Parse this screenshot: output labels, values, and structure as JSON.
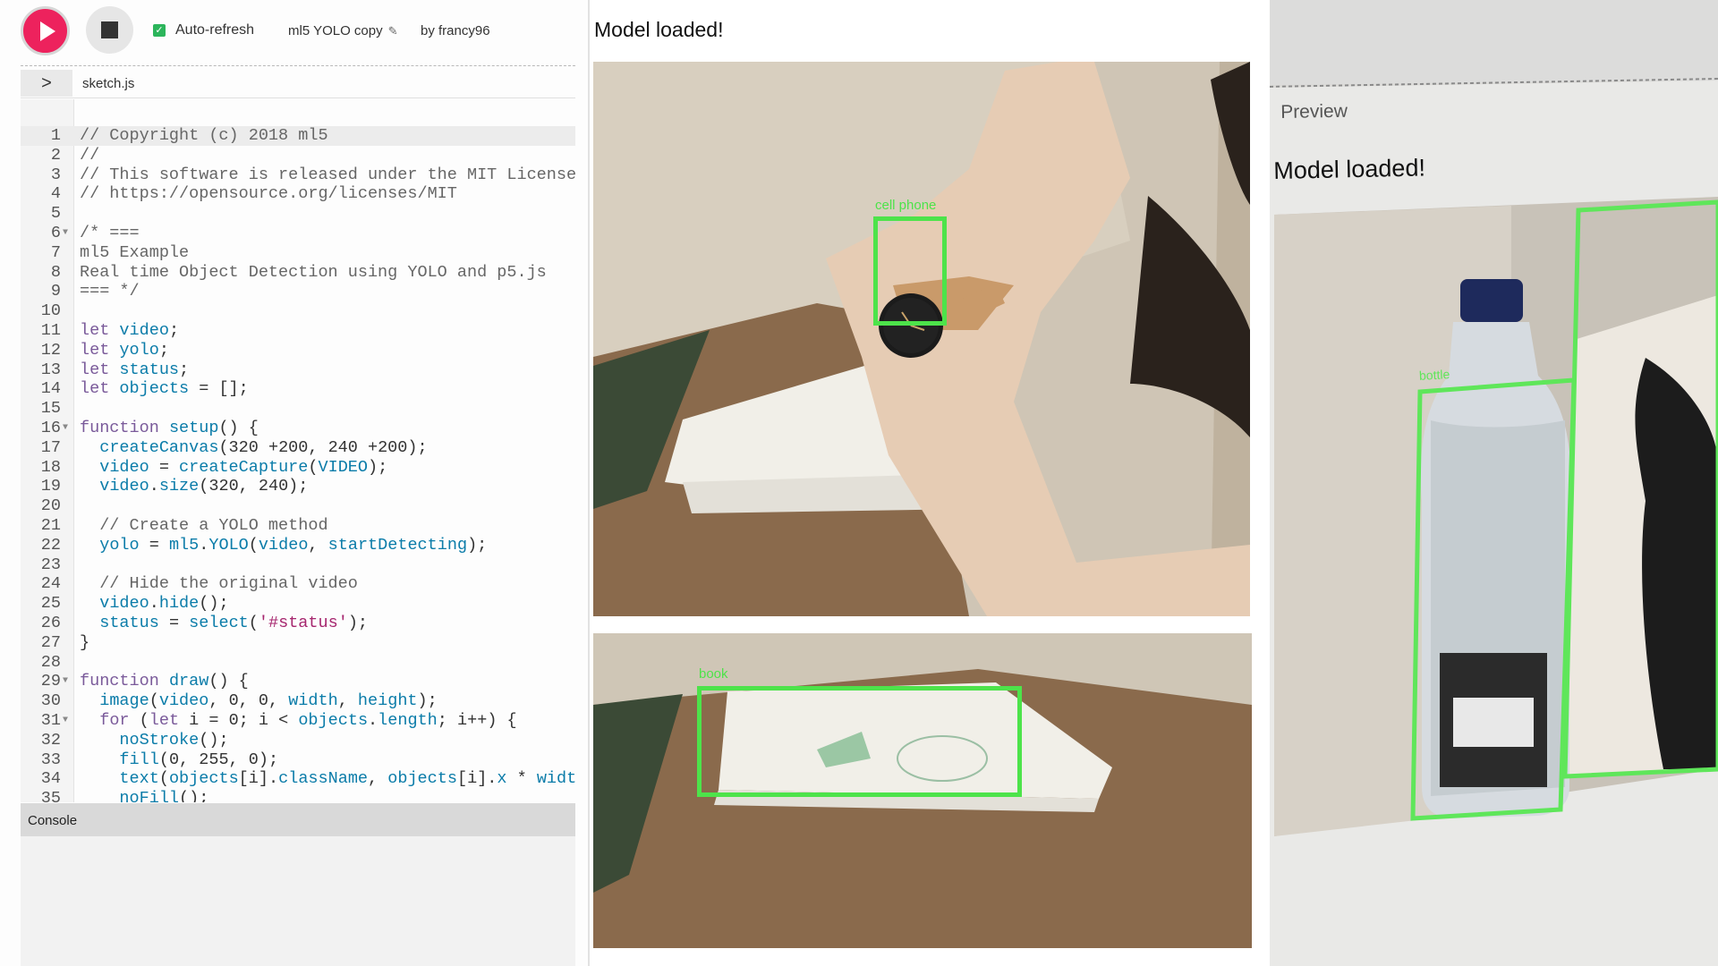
{
  "toolbar": {
    "auto_refresh_label": "Auto-refresh",
    "auto_refresh_checked": true,
    "sketch_name": "ml5 YOLO copy",
    "author": "by francy96",
    "play_color": "#ed225d"
  },
  "file_tab": {
    "expand_glyph": ">",
    "filename": "sketch.js"
  },
  "editor": {
    "active_line": 1,
    "lines": [
      {
        "n": "1",
        "text": "// Copyright (c) 2018 ml5"
      },
      {
        "n": "2",
        "text": "//"
      },
      {
        "n": "3",
        "text": "// This software is released under the MIT License."
      },
      {
        "n": "4",
        "text": "// https://opensource.org/licenses/MIT"
      },
      {
        "n": "5",
        "text": ""
      },
      {
        "n": "6",
        "text": "/* ===",
        "fold": true
      },
      {
        "n": "7",
        "text": "ml5 Example"
      },
      {
        "n": "8",
        "text": "Real time Object Detection using YOLO and p5.js"
      },
      {
        "n": "9",
        "text": "=== */"
      },
      {
        "n": "10",
        "text": ""
      },
      {
        "n": "11",
        "text": "let video;"
      },
      {
        "n": "12",
        "text": "let yolo;"
      },
      {
        "n": "13",
        "text": "let status;"
      },
      {
        "n": "14",
        "text": "let objects = [];"
      },
      {
        "n": "15",
        "text": ""
      },
      {
        "n": "16",
        "text": "function setup() {",
        "fold": true
      },
      {
        "n": "17",
        "text": "  createCanvas(320 +200, 240 +200);"
      },
      {
        "n": "18",
        "text": "  video = createCapture(VIDEO);"
      },
      {
        "n": "19",
        "text": "  video.size(320, 240);"
      },
      {
        "n": "20",
        "text": ""
      },
      {
        "n": "21",
        "text": "  // Create a YOLO method"
      },
      {
        "n": "22",
        "text": "  yolo = ml5.YOLO(video, startDetecting);"
      },
      {
        "n": "23",
        "text": ""
      },
      {
        "n": "24",
        "text": "  // Hide the original video"
      },
      {
        "n": "25",
        "text": "  video.hide();"
      },
      {
        "n": "26",
        "text": "  status = select('#status');"
      },
      {
        "n": "27",
        "text": "}"
      },
      {
        "n": "28",
        "text": ""
      },
      {
        "n": "29",
        "text": "function draw() {",
        "fold": true
      },
      {
        "n": "30",
        "text": "  image(video, 0, 0, width, height);"
      },
      {
        "n": "31",
        "text": "  for (let i = 0; i < objects.length; i++) {",
        "fold": true
      },
      {
        "n": "32",
        "text": "    noStroke();"
      },
      {
        "n": "33",
        "text": "    fill(0, 255, 0);"
      },
      {
        "n": "34",
        "text": "    text(objects[i].className, objects[i].x * width"
      },
      {
        "n": "35",
        "text": "    noFill();"
      }
    ]
  },
  "console": {
    "label": "Console"
  },
  "canvas_preview": {
    "status_text": "Model loaded!",
    "frame1_label": "cell phone",
    "frame2_label": "book",
    "detection_color": "#4de34a"
  },
  "photo_preview": {
    "section_label": "Preview",
    "status_text": "Model loaded!",
    "detection_label": "bottle"
  }
}
